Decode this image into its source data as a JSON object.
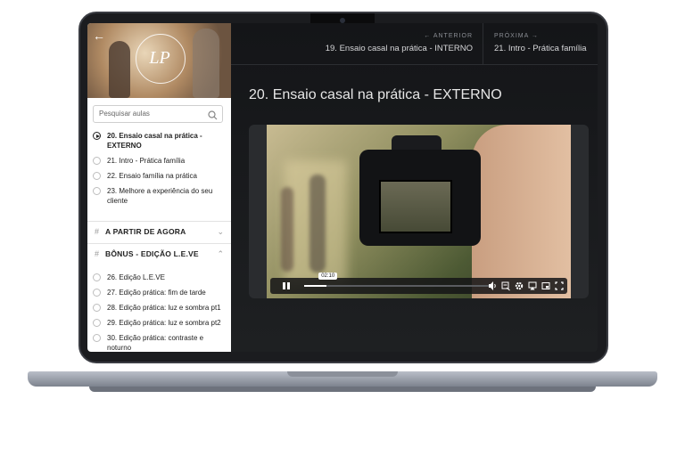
{
  "sidebar": {
    "search_placeholder": "Pesquisar aulas",
    "logo_text": "LP",
    "lessons_top": [
      {
        "label": "20. Ensaio casal na prática - EXTERNO",
        "active": true
      },
      {
        "label": "21. Intro - Prática família",
        "active": false
      },
      {
        "label": "22. Ensaio família na prática",
        "active": false
      },
      {
        "label": "23. Melhore a experiência do seu cliente",
        "active": false
      }
    ],
    "sections": [
      {
        "title": "A PARTIR DE AGORA",
        "state": "collapsed"
      },
      {
        "title": "BÔNUS - EDIÇÃO L.E.VE",
        "state": "expanded"
      }
    ],
    "lessons_bonus": [
      {
        "label": "26. Edição L.E.VE"
      },
      {
        "label": "27. Edição prática: fim de tarde"
      },
      {
        "label": "28. Edição prática: luz e sombra pt1"
      },
      {
        "label": "29. Edição prática: luz e sombra pt2"
      },
      {
        "label": "30. Edição prática: contraste e noturno"
      }
    ]
  },
  "nav": {
    "prev_label": "← ANTERIOR",
    "prev_title": "19. Ensaio casal na prática - INTERNO",
    "next_label": "PRÓXIMA →",
    "next_title": "21. Intro - Prática família"
  },
  "main": {
    "lesson_title": "20. Ensaio casal na prática - EXTERNO"
  },
  "player": {
    "current_time": "02:10",
    "progress": 0.12,
    "icons": [
      "pause-icon",
      "volume-icon",
      "captions-icon",
      "settings-icon",
      "airplay-icon",
      "pip-icon",
      "fullscreen-icon"
    ]
  }
}
